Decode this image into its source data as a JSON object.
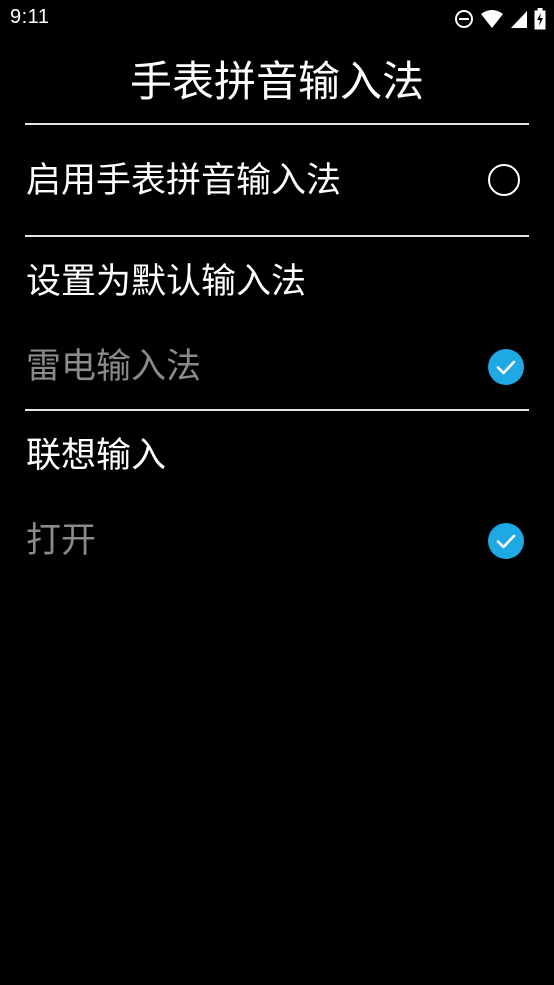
{
  "status_bar": {
    "time": "9:11",
    "icons": [
      "do-not-disturb-icon",
      "wifi-icon",
      "cell-signal-icon",
      "battery-charging-icon"
    ]
  },
  "page": {
    "title": "手表拼音输入法"
  },
  "settings": [
    {
      "label": "启用手表拼音输入法",
      "checked": false
    },
    {
      "label": "设置为默认输入法",
      "value": "雷电输入法",
      "checked": true
    },
    {
      "label": "联想输入",
      "value": "打开",
      "checked": true
    }
  ],
  "colors": {
    "background": "#000000",
    "text": "#ffffff",
    "secondary_text": "#8a8a8a",
    "accent": "#1ea8e4"
  }
}
